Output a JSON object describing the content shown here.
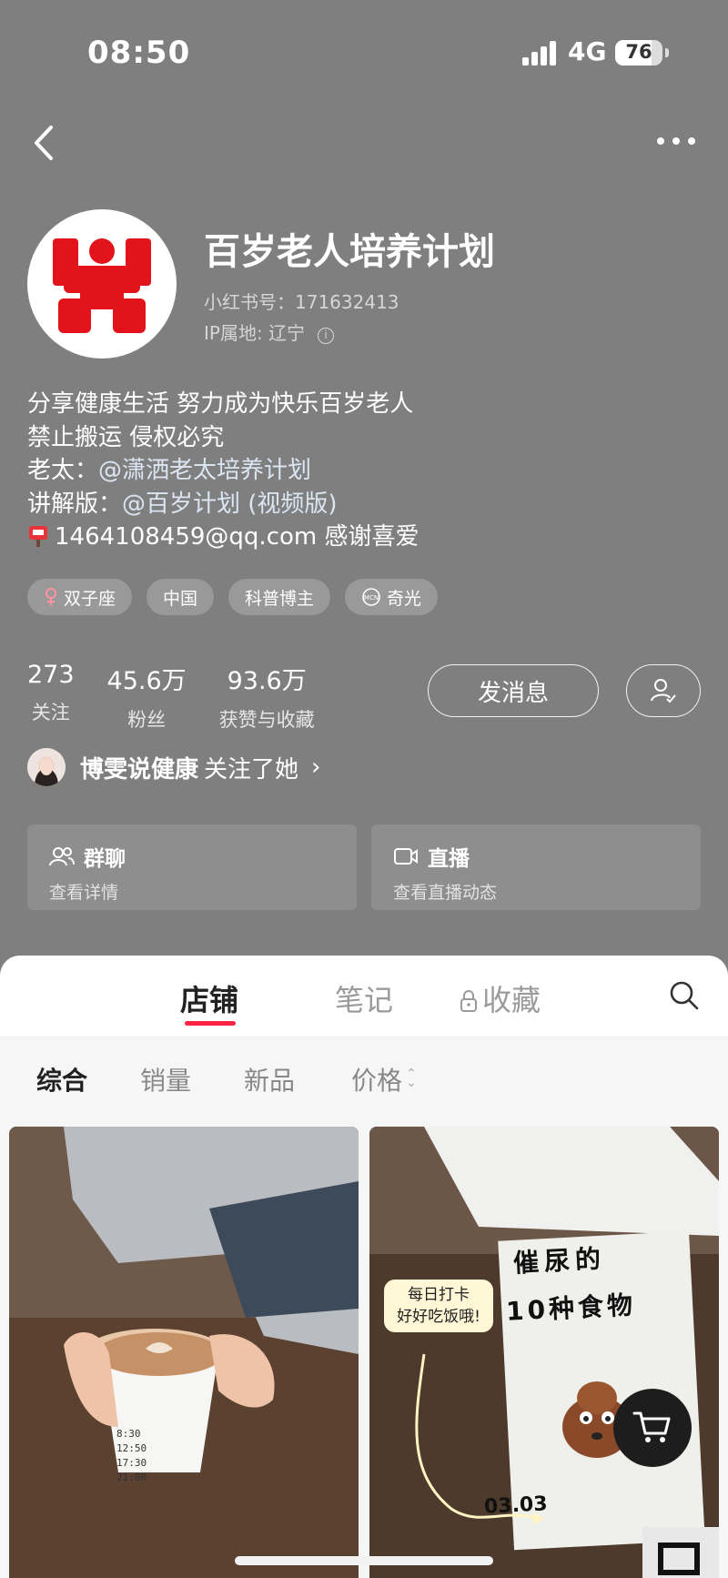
{
  "status_bar": {
    "time": "08:50",
    "network": "4G",
    "battery": "76",
    "battery_level": 0.76
  },
  "profile": {
    "name": "百岁老人培养计划",
    "red_id": "小红书号：171632413",
    "ip": "IP属地: 辽宁",
    "bio": {
      "line1": "分享健康生活 努力成为快乐百岁老人",
      "line2": "禁止搬运 侵权必究",
      "line3_prefix": "老太：",
      "line3_mention": "@潇洒老太培养计划",
      "line4_prefix": "讲解版：",
      "line4_mention": "@百岁计划 (视频版)",
      "line5": "1464108459@qq.com 感谢喜爱"
    },
    "tags": [
      {
        "label": "双子座",
        "icon": "female-icon"
      },
      {
        "label": "中国"
      },
      {
        "label": "科普博主"
      },
      {
        "label": "奇光",
        "icon": "mcn-icon"
      }
    ],
    "stats": [
      {
        "num": "273",
        "label": "关注"
      },
      {
        "num": "45.6万",
        "label": "粉丝"
      },
      {
        "num": "93.6万",
        "label": "获赞与收藏"
      }
    ],
    "message_button": "发消息",
    "followed_by": {
      "name": "博雯说健康",
      "text": "关注了她"
    },
    "cards": [
      {
        "title": "群聊",
        "sub": "查看详情",
        "icon": "group-icon"
      },
      {
        "title": "直播",
        "sub": "查看直播动态",
        "icon": "live-icon"
      }
    ]
  },
  "tabs": [
    {
      "label": "店铺",
      "active": true
    },
    {
      "label": "笔记",
      "active": false
    },
    {
      "label": "收藏",
      "active": false,
      "locked": true
    }
  ],
  "filters": [
    {
      "label": "综合",
      "active": true
    },
    {
      "label": "销量"
    },
    {
      "label": "新品"
    },
    {
      "label": "价格"
    }
  ],
  "products": {
    "card2_bubble_line1": "每日打卡",
    "card2_bubble_line2": "好好吃饭哦!",
    "poster_line1": "催尿的",
    "poster_line2": "10种食物",
    "poster_date": "03.03",
    "cup_times": [
      "8:30",
      "12:50",
      "17:30",
      "21:00"
    ]
  },
  "colors": {
    "accent": "#ff2442",
    "overlay": "#7f7f7f",
    "logo_red": "#e3131b"
  }
}
